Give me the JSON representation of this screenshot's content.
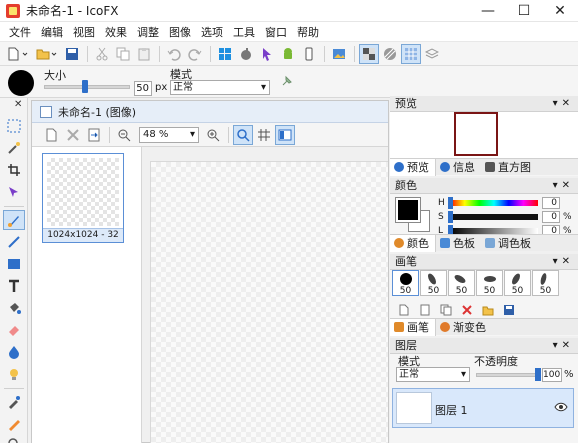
{
  "window": {
    "title": "未命名-1 - IcoFX",
    "minimize": "—",
    "maximize": "☐",
    "close": "✕"
  },
  "menu": [
    "文件",
    "编辑",
    "视图",
    "效果",
    "调整",
    "图像",
    "选项",
    "工具",
    "窗口",
    "帮助"
  ],
  "brush_options": {
    "size_label": "大小",
    "size_value": "50",
    "size_unit": "px",
    "mode_label": "模式",
    "mode_value": "正常"
  },
  "document": {
    "title": "未命名-1 (图像)",
    "zoom": "48 %",
    "thumbnail_caption": "1024x1024 - 32"
  },
  "panels": {
    "preview": {
      "title": "预览",
      "tabs": [
        "预览",
        "信息",
        "直方图"
      ]
    },
    "color": {
      "title": "颜色",
      "h_label": "H",
      "h_value": "0",
      "s_label": "S",
      "s_value": "0",
      "s_unit": "%",
      "l_label": "L",
      "l_value": "0",
      "l_unit": "%",
      "tabs": [
        "颜色",
        "色板",
        "调色板"
      ],
      "foreground": "#000000",
      "background": "#ffffff"
    },
    "brush": {
      "title": "画笔",
      "sizes": [
        "50",
        "50",
        "50",
        "50",
        "50",
        "50"
      ],
      "tabs": [
        "画笔",
        "渐变色"
      ]
    },
    "layers": {
      "title": "图层",
      "mode_label": "模式",
      "mode_value": "正常",
      "opacity_label": "不透明度",
      "opacity_value": "100",
      "opacity_unit": "%",
      "layer_name": "图层 1"
    }
  },
  "colors": {
    "accent": "#2e6fc9",
    "preview_border": "#7a1515",
    "selection": "#d9e8fb"
  }
}
